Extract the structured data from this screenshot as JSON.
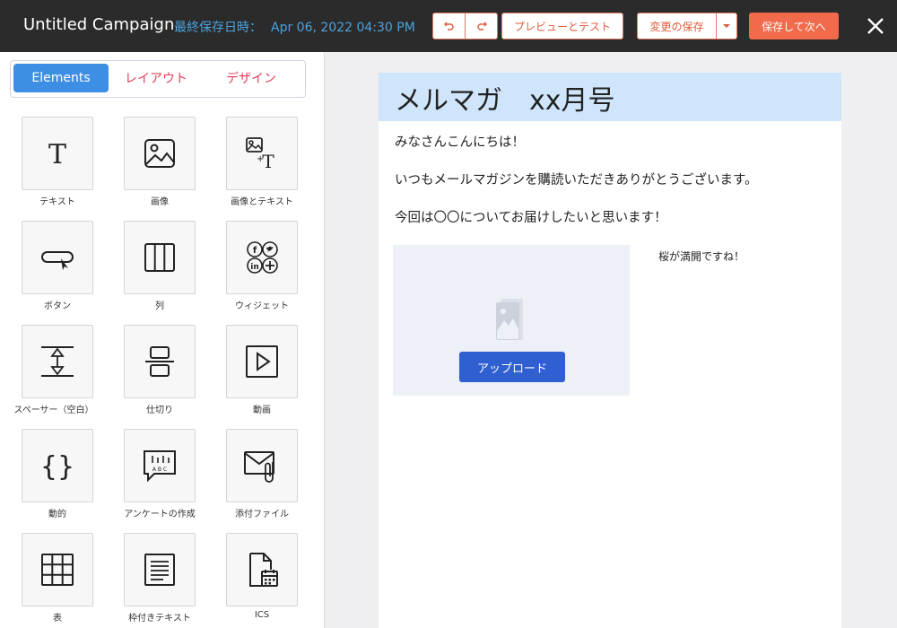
{
  "header": {
    "title": "Untitled Campaign",
    "saved_label": "最終保存日時：",
    "saved_time": "Apr 06, 2022 04:30 PM",
    "undo_icon": "undo-icon",
    "redo_icon": "redo-icon",
    "preview_label": "プレビューとテスト",
    "save_label": "変更の保存",
    "save_next_label": "保存して次へ",
    "close_icon": "close-icon"
  },
  "sidebar": {
    "tabs": [
      {
        "label": "Elements",
        "active": true
      },
      {
        "label": "レイアウト",
        "active": false
      },
      {
        "label": "デザイン",
        "active": false
      }
    ],
    "elements": [
      {
        "label": "テキスト",
        "icon": "text-icon"
      },
      {
        "label": "画像",
        "icon": "image-icon"
      },
      {
        "label": "画像とテキスト",
        "icon": "image-text-icon"
      },
      {
        "label": "ボタン",
        "icon": "button-icon"
      },
      {
        "label": "列",
        "icon": "columns-icon"
      },
      {
        "label": "ウィジェット",
        "icon": "social-widget-icon"
      },
      {
        "label": "スペーサー（空白）",
        "icon": "spacer-icon"
      },
      {
        "label": "仕切り",
        "icon": "divider-icon"
      },
      {
        "label": "動画",
        "icon": "video-icon"
      },
      {
        "label": "動的",
        "icon": "dynamic-icon"
      },
      {
        "label": "アンケートの作成",
        "icon": "survey-icon"
      },
      {
        "label": "添付ファイル",
        "icon": "attachment-icon"
      },
      {
        "label": "表",
        "icon": "table-icon"
      },
      {
        "label": "枠付きテキスト",
        "icon": "boxed-text-icon"
      },
      {
        "label": "ICS",
        "icon": "ics-calendar-icon"
      }
    ]
  },
  "email": {
    "title": "メルマガ　xx月号",
    "lines": [
      "みなさんこんにちは！",
      "いつもメールマガジンを購読いただきありがとうございます。",
      "今回は〇〇についてお届けしたいと思います！"
    ],
    "upload_label": "アップロード",
    "side_text": "桜が満開ですね！"
  },
  "colors": {
    "topbar": "#2b2b2b",
    "accent_blue": "#3d8fe6",
    "accent_orange": "#f06a4b",
    "header_band": "#cfe5fb",
    "upload_button": "#2f5fd0"
  }
}
